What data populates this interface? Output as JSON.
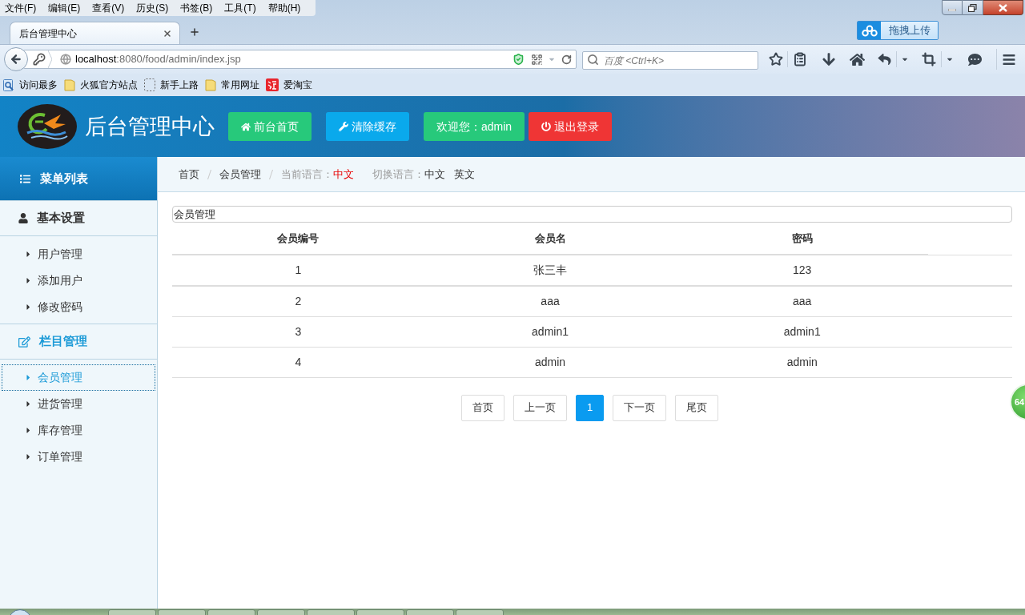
{
  "browser": {
    "menu_bar": [
      "文件(F)",
      "编辑(E)",
      "查看(V)",
      "历史(S)",
      "书签(B)",
      "工具(T)",
      "帮助(H)"
    ],
    "tab": {
      "title": "后台管理中心",
      "selected": true
    },
    "upload_button": "拖拽上传",
    "address_bar": {
      "host": "localhost",
      "path": ":8080/food/admin/index.jsp"
    },
    "search": {
      "placeholder": "百度 <Ctrl+K>"
    },
    "bookmarks": [
      {
        "label": "访问最多",
        "kind": "smart"
      },
      {
        "label": "火狐官方站点",
        "kind": "folder"
      },
      {
        "label": "新手上路",
        "kind": "page"
      },
      {
        "label": "常用网址",
        "kind": "folder"
      },
      {
        "label": "爱淘宝",
        "kind": "shop"
      }
    ]
  },
  "header": {
    "title": "后台管理中心",
    "buttons": [
      {
        "label": "前台首页",
        "kind": "home",
        "color": "#27c97b"
      },
      {
        "label": "清除缓存",
        "kind": "wrench",
        "color": "#0aa9ec"
      }
    ],
    "user": {
      "greeting": "欢迎您：admin",
      "logout": "退出登录"
    }
  },
  "sidebar": {
    "title": "菜单列表",
    "sections": [
      {
        "label": "基本设置",
        "kind": "user",
        "selected": false,
        "children": [
          {
            "label": "用户管理",
            "selected": false
          },
          {
            "label": "添加用户",
            "selected": false
          },
          {
            "label": "修改密码",
            "selected": false
          }
        ]
      },
      {
        "label": "栏目管理",
        "kind": "edit",
        "selected": true,
        "children": [
          {
            "label": "会员管理",
            "selected": true
          },
          {
            "label": "进货管理",
            "selected": false
          },
          {
            "label": "库存管理",
            "selected": false
          },
          {
            "label": "订单管理",
            "selected": false
          }
        ]
      }
    ]
  },
  "breadcrumb": [
    {
      "kind": "link",
      "label": "首页"
    },
    {
      "kind": "link",
      "label": "会员管理"
    },
    {
      "kind": "status",
      "label": "当前语言：",
      "value": "中文"
    }
  ],
  "language_switch": {
    "label": "切换语言：",
    "options": [
      "中文",
      "英文"
    ]
  },
  "panel": {
    "title": "会员管理",
    "table": {
      "columns": [
        "会员编号",
        "会员名",
        "密码"
      ],
      "rows": [
        [
          "1",
          "张三丰",
          "123"
        ],
        [
          "2",
          "aaa",
          "aaa"
        ],
        [
          "3",
          "admin1",
          "admin1"
        ],
        [
          "4",
          "admin",
          "admin"
        ]
      ]
    }
  },
  "pagination": [
    {
      "label": "首页",
      "selected": false
    },
    {
      "label": "上一页",
      "selected": false
    },
    {
      "label": "1",
      "selected": true
    },
    {
      "label": "下一页",
      "selected": false
    },
    {
      "label": "尾页",
      "selected": false
    }
  ],
  "floating_ball": {
    "label": "64"
  }
}
